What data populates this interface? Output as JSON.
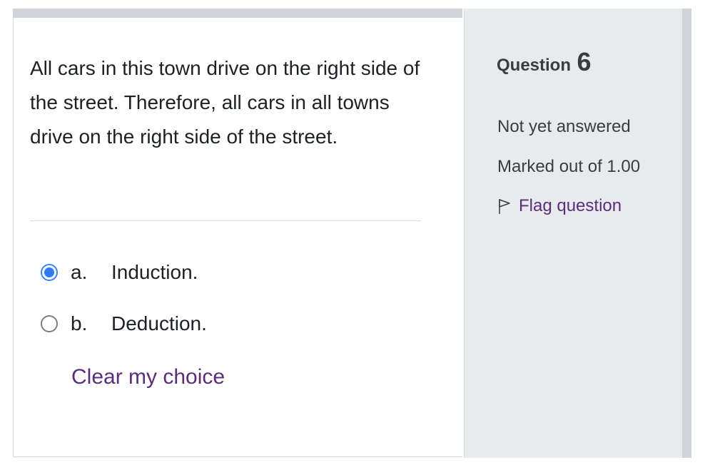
{
  "question": {
    "text": "All cars in this town drive on the right side of the street. Therefore, all cars in all towns drive on the right side of the street.",
    "answers": [
      {
        "number": "a.",
        "label": "Induction.",
        "selected": true
      },
      {
        "number": "b.",
        "label": "Deduction.",
        "selected": false
      }
    ],
    "clear_label": "Clear my choice"
  },
  "info": {
    "question_label": "Question",
    "question_number": "6",
    "state": "Not yet answered",
    "grade": "Marked out of 1.00",
    "flag_label": "Flag question",
    "flag_icon": "flag-outline-icon"
  },
  "colors": {
    "accent": "#2f7bf5",
    "link": "#5b2d7a",
    "info_bg": "#e8ebee"
  }
}
